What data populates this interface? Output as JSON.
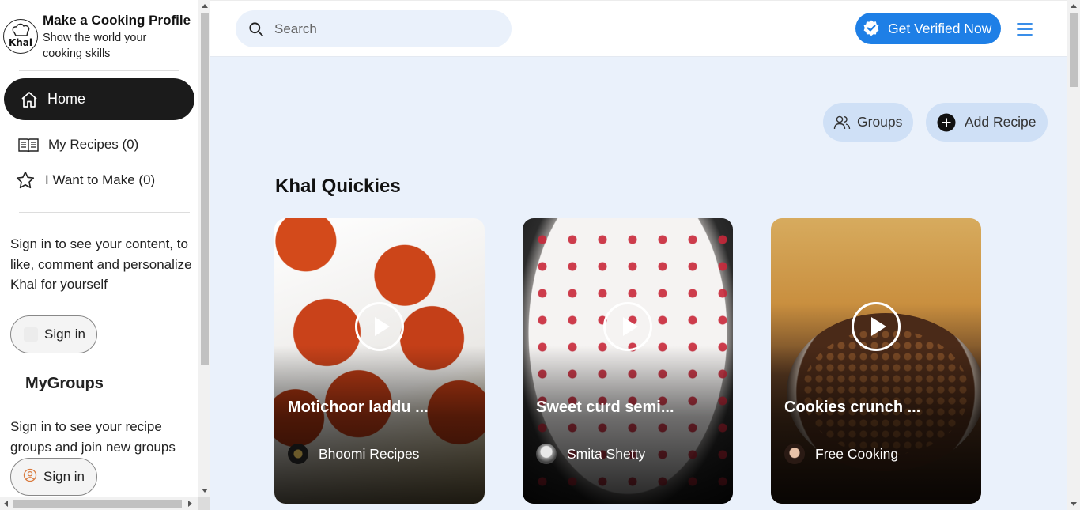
{
  "brand": {
    "logo_text": "Khal",
    "title": "Make a Cooking Profile",
    "subtitle": "Show the world your cooking skills"
  },
  "nav": {
    "home": "Home",
    "my_recipes": "My Recipes (0)",
    "want_to_make": "I Want to Make (0)"
  },
  "sidebar": {
    "signin_prompt": "Sign in to see your content, to like, comment and personalize Khal for yourself",
    "signin_label": "Sign in",
    "mygroups_title": "MyGroups",
    "groups_prompt": "Sign in to see your recipe groups and join new groups",
    "signin_label_2": "Sign in"
  },
  "header": {
    "search_placeholder": "Search",
    "verify_label": "Get Verified Now"
  },
  "actions": {
    "groups": "Groups",
    "add_recipe": "Add Recipe"
  },
  "section": {
    "title": "Khal Quickies"
  },
  "cards": [
    {
      "title": "Motichoor laddu ...",
      "author": "Bhoomi Recipes"
    },
    {
      "title": "Sweet curd semi...",
      "author": "Smita Shetty"
    },
    {
      "title": "Cookies crunch ...",
      "author": "Free Cooking"
    }
  ],
  "colors": {
    "accent": "#1e7fe6",
    "main_bg": "#eaf1fb",
    "pill_bg": "#cfe0f6",
    "nav_active": "#1b1b1b"
  }
}
